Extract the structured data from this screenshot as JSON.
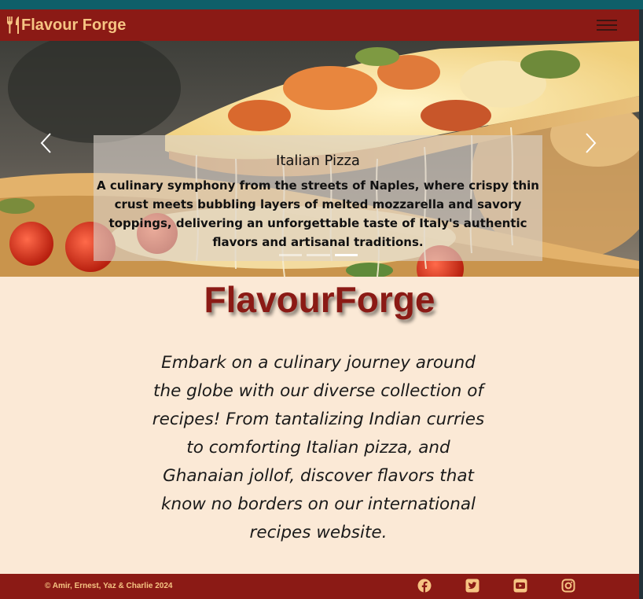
{
  "brand": {
    "name": "Flavour Forge",
    "icon": "utensils-icon",
    "color": "#f6c483"
  },
  "colors": {
    "primary": "#8b1a15",
    "background": "#fbe9d6",
    "accent": "#f6c483"
  },
  "navbar": {
    "toggle_icon": "hamburger-menu-icon"
  },
  "carousel": {
    "slides_count": 3,
    "active_index": 2,
    "caption": {
      "title": "Italian Pizza",
      "text": "A culinary symphony from the streets of Naples, where crispy thin crust meets bubbling layers of melted mozzarella and savory toppings, delivering an unforgettable taste of Italy's authentic flavors and artisanal traditions."
    },
    "prev_icon": "chevron-left-icon",
    "next_icon": "chevron-right-icon"
  },
  "main": {
    "title": "FlavourForge",
    "intro": "Embark on a culinary journey around the globe with our diverse collection of recipes! From tantalizing Indian curries to comforting Italian pizza, and Ghanaian jollof, discover flavors that know no borders on our international recipes website."
  },
  "footer": {
    "copyright": "© Amir, Ernest, Yaz & Charlie 2024",
    "social": [
      "facebook-icon",
      "twitter-icon",
      "youtube-icon",
      "instagram-icon"
    ]
  }
}
